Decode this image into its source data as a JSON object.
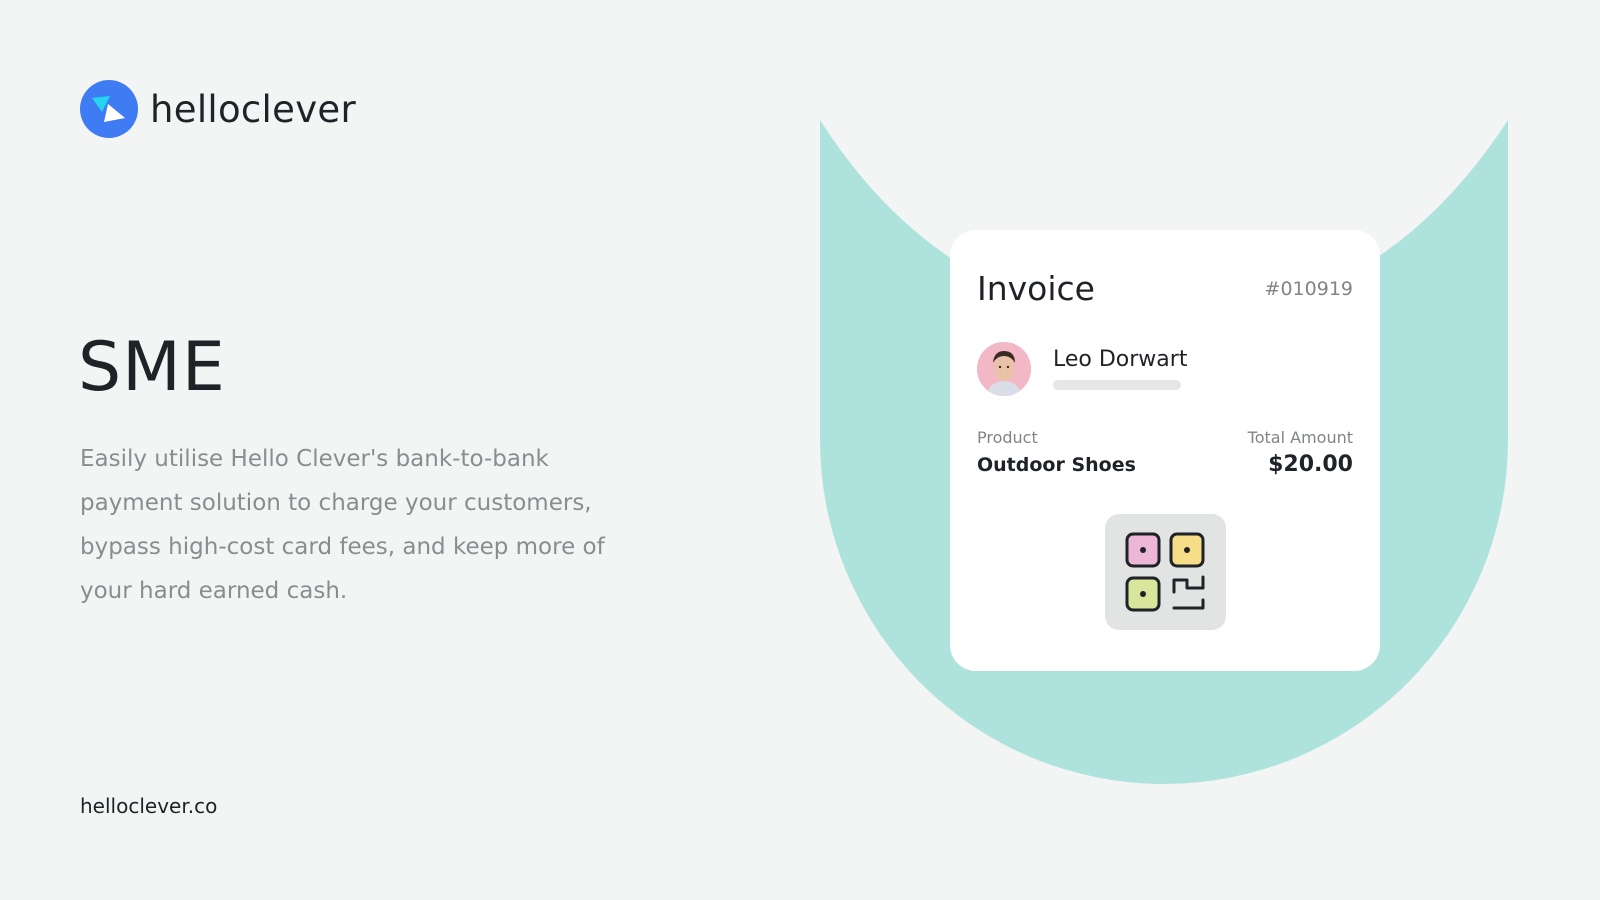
{
  "brand": {
    "name": "helloclever",
    "logo_icon": "helloclever-logo-icon",
    "logo_color": "#3f7cf4",
    "accent_teal": "#aee3dd"
  },
  "hero": {
    "title": "SME",
    "description": "Easily utilise Hello Clever's bank-to-bank payment solution to charge your customers, bypass high-cost card fees, and keep more of your hard earned cash."
  },
  "footer": {
    "url": "helloclever.co"
  },
  "invoice": {
    "title": "Invoice",
    "number": "#010919",
    "customer_name": "Leo Dorwart",
    "product_label": "Product",
    "product_value": "Outdoor Shoes",
    "amount_label": "Total Amount",
    "amount_value": "$20.00",
    "qr_icon": "qr-code-icon"
  }
}
